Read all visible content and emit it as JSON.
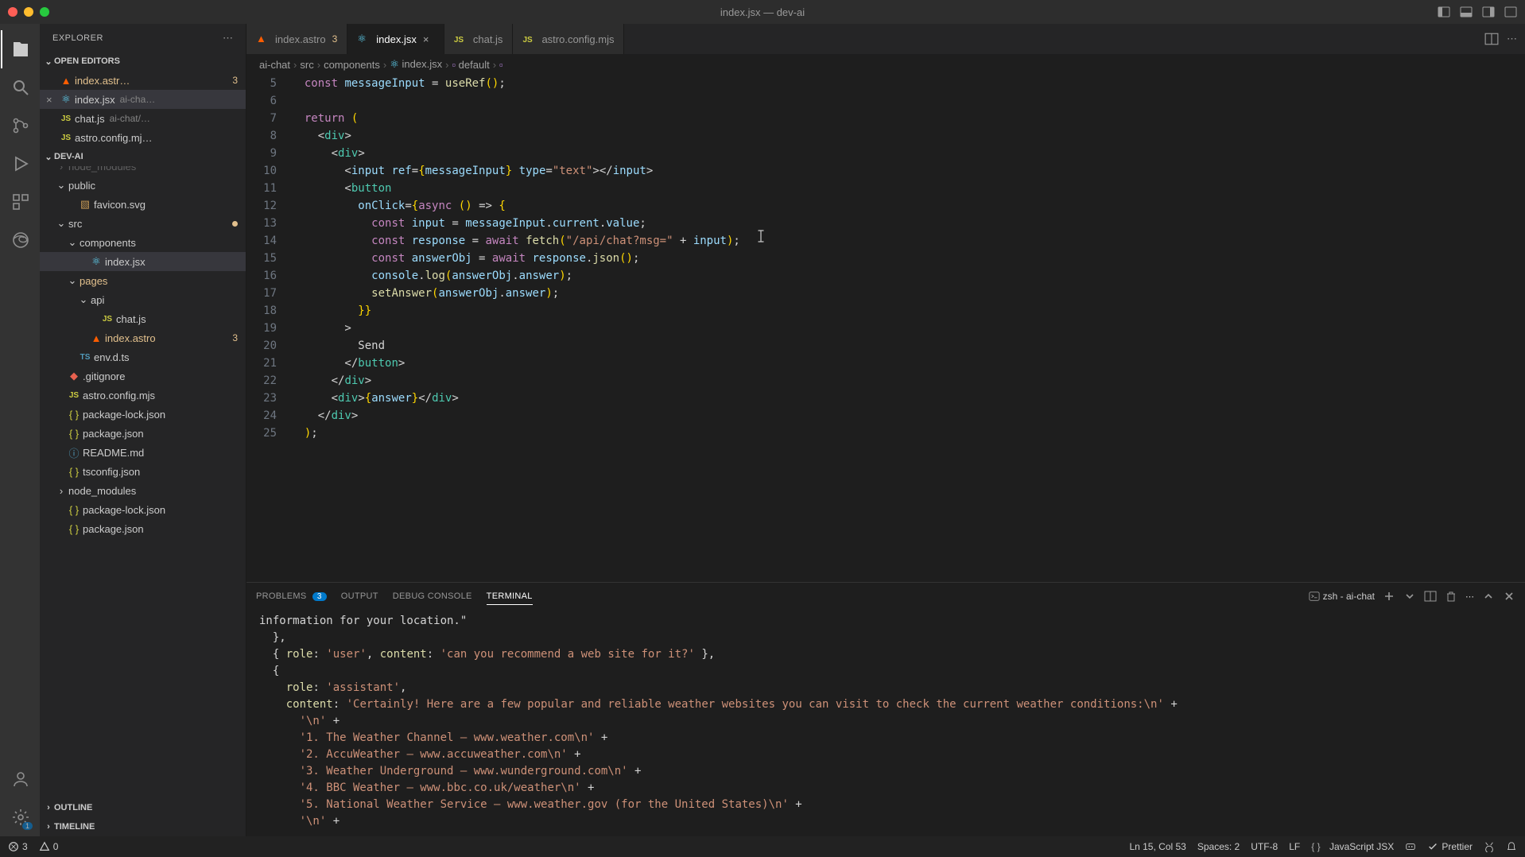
{
  "window": {
    "title": "index.jsx — dev-ai"
  },
  "sidebar": {
    "title": "EXPLORER",
    "sections": {
      "openEditors": "OPEN EDITORS",
      "project": "DEV-AI",
      "outline": "OUTLINE",
      "timeline": "TIMELINE"
    },
    "openEditors": [
      {
        "name": "index.astr…",
        "badge": "3",
        "kind": "astro"
      },
      {
        "name": "index.jsx",
        "dim": "ai-cha…",
        "kind": "react",
        "active": true
      },
      {
        "name": "chat.js",
        "dim": "ai-chat/…",
        "kind": "js"
      },
      {
        "name": "astro.config.mj…",
        "kind": "js"
      }
    ],
    "tree": [
      {
        "d": 0,
        "name": "node_modules",
        "folder": true,
        "half": true
      },
      {
        "d": 0,
        "name": "public",
        "folder": true,
        "open": true
      },
      {
        "d": 1,
        "name": "favicon.svg",
        "kind": "svg"
      },
      {
        "d": 0,
        "name": "src",
        "folder": true,
        "open": true,
        "mod": true
      },
      {
        "d": 1,
        "name": "components",
        "folder": true,
        "open": true
      },
      {
        "d": 2,
        "name": "index.jsx",
        "kind": "react",
        "selected": true
      },
      {
        "d": 1,
        "name": "pages",
        "folder": true,
        "open": true,
        "folderMod": true
      },
      {
        "d": 2,
        "name": "api",
        "folder": true,
        "open": true
      },
      {
        "d": 3,
        "name": "chat.js",
        "kind": "js"
      },
      {
        "d": 2,
        "name": "index.astro",
        "kind": "astro",
        "badge": "3",
        "fileMod": true
      },
      {
        "d": 1,
        "name": "env.d.ts",
        "kind": "ts"
      },
      {
        "d": 0,
        "name": ".gitignore",
        "kind": "git"
      },
      {
        "d": 0,
        "name": "astro.config.mjs",
        "kind": "js"
      },
      {
        "d": 0,
        "name": "package-lock.json",
        "kind": "json"
      },
      {
        "d": 0,
        "name": "package.json",
        "kind": "json"
      },
      {
        "d": 0,
        "name": "README.md",
        "kind": "md"
      },
      {
        "d": 0,
        "name": "tsconfig.json",
        "kind": "json"
      },
      {
        "d": 0,
        "name": "node_modules",
        "folder": true
      },
      {
        "d": 0,
        "name": "package-lock.json",
        "kind": "json"
      },
      {
        "d": 0,
        "name": "package.json",
        "kind": "json"
      }
    ]
  },
  "tabs": [
    {
      "name": "index.astro",
      "kind": "astro",
      "badge": "3"
    },
    {
      "name": "index.jsx",
      "kind": "react",
      "active": true,
      "close": true
    },
    {
      "name": "chat.js",
      "kind": "js"
    },
    {
      "name": "astro.config.mjs",
      "kind": "js"
    }
  ],
  "breadcrumbs": [
    "ai-chat",
    "src",
    "components",
    "index.jsx",
    "default",
    "<function>"
  ],
  "code": {
    "start": 5,
    "lines": [
      "  const messageInput = useRef();",
      "",
      "  return (",
      "    <div>",
      "      <div>",
      "        <input ref={messageInput} type=\"text\"></input>",
      "        <button",
      "          onClick={async () => {",
      "            const input = messageInput.current.value;",
      "            const response = await fetch(\"/api/chat?msg=\" + input);",
      "            const answerObj = await response.json();",
      "            console.log(answerObj.answer);",
      "            setAnswer(answerObj.answer);",
      "          }}",
      "        >",
      "          Send",
      "        </button>",
      "      </div>",
      "      <div>{answer}</div>",
      "    </div>",
      "  );"
    ]
  },
  "panel": {
    "tabs": {
      "problems": "PROBLEMS",
      "problemsBadge": "3",
      "output": "OUTPUT",
      "debug": "DEBUG CONSOLE",
      "terminal": "TERMINAL"
    },
    "termLabel": "zsh - ai-chat",
    "terminal": [
      "information for your location.\"",
      "  },",
      "  { role: 'user', content: 'can you recommend a web site for it?' },",
      "  {",
      "    role: 'assistant',",
      "    content: 'Certainly! Here are a few popular and reliable weather websites you can visit to check the current weather conditions:\\n' +",
      "      '\\n' +",
      "      '1. The Weather Channel – www.weather.com\\n' +",
      "      '2. AccuWeather – www.accuweather.com\\n' +",
      "      '3. Weather Underground – www.wunderground.com\\n' +",
      "      '4. BBC Weather – www.bbc.co.uk/weather\\n' +",
      "      '5. National Weather Service – www.weather.gov (for the United States)\\n' +",
      "      '\\n' +"
    ]
  },
  "status": {
    "errors": "3",
    "warnings": "0",
    "pos": "Ln 15, Col 53",
    "spaces": "Spaces: 2",
    "enc": "UTF-8",
    "eol": "LF",
    "lang": "JavaScript JSX",
    "prettier": "Prettier"
  },
  "activityBadge": "1"
}
